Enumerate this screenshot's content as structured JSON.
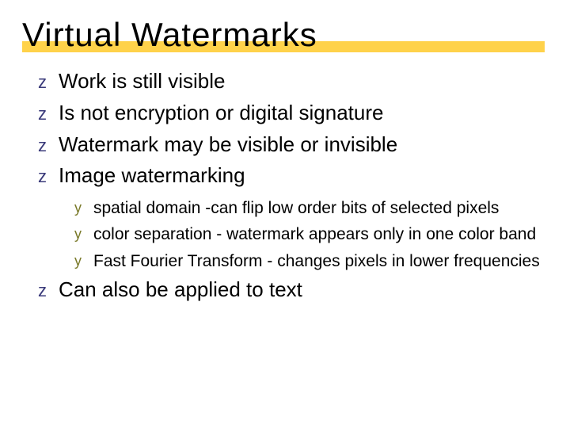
{
  "slide": {
    "title": "Virtual Watermarks",
    "bullets": {
      "b0": "Work is still visible",
      "b1": "Is not encryption or digital signature",
      "b2": "Watermark may be visible or invisible",
      "b3": "Image watermarking",
      "b4": "Can also be applied to text"
    },
    "sub": {
      "s0": "spatial domain -can flip low order bits of selected pixels",
      "s1": "color separation - watermark appears only in one color band",
      "s2": "Fast Fourier Transform - changes pixels in lower frequencies"
    }
  }
}
